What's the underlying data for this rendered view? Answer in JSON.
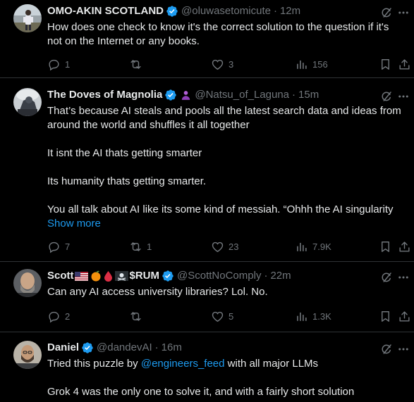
{
  "posts": [
    {
      "name": "OMO-AKIN SCOTLAND",
      "handle": "@oluwasetomicute",
      "time": "12m",
      "text": [
        "How does one check to know it's the correct solution to the question if it's",
        "not on the Internet or any books."
      ],
      "reply_count": "1",
      "retweet_count": "",
      "like_count": "3",
      "view_count": "156"
    },
    {
      "name": "The Doves of Magnolia",
      "handle": "@Natsu_of_Laguna",
      "time": "15m",
      "paragraphs": [
        [
          "That’s because AI steals and pools all the latest search data and ideas from",
          "around the world and shuffles it all together"
        ],
        [
          "It isnt the AI thats getting smarter"
        ],
        [
          "Its humanity thats getting smarter."
        ],
        [
          "You all talk about AI like its some kind of messiah. “Ohhh the AI singularity"
        ]
      ],
      "show_more": "Show more",
      "reply_count": "7",
      "retweet_count": "1",
      "like_count": "23",
      "view_count": "7.9K"
    },
    {
      "name": "Scott",
      "name_suffix": "$RUM",
      "name_emojis": [
        "us-flag",
        "orange",
        "blood-drop",
        "pirate-flag"
      ],
      "handle": "@ScottNoComply",
      "time": "22m",
      "text": [
        "Can any AI access university libraries? Lol. No."
      ],
      "reply_count": "2",
      "retweet_count": "",
      "like_count": "5",
      "view_count": "1.3K"
    },
    {
      "name": "Daniel",
      "handle": "@dandevAI",
      "time": "16m",
      "text_before_mention": "Tried this puzzle by ",
      "mention": "@engineers_feed",
      "text_after_mention": " with all major LLMs",
      "text2": "Grok 4 was the only one to solve it, and with a fairly short solution"
    }
  ],
  "colors": {
    "background": "#000000",
    "text": "#e7e9ea",
    "muted": "#71767b",
    "link": "#1d9bf0",
    "verified": "#1d9bf0",
    "divider": "#2f3336"
  }
}
